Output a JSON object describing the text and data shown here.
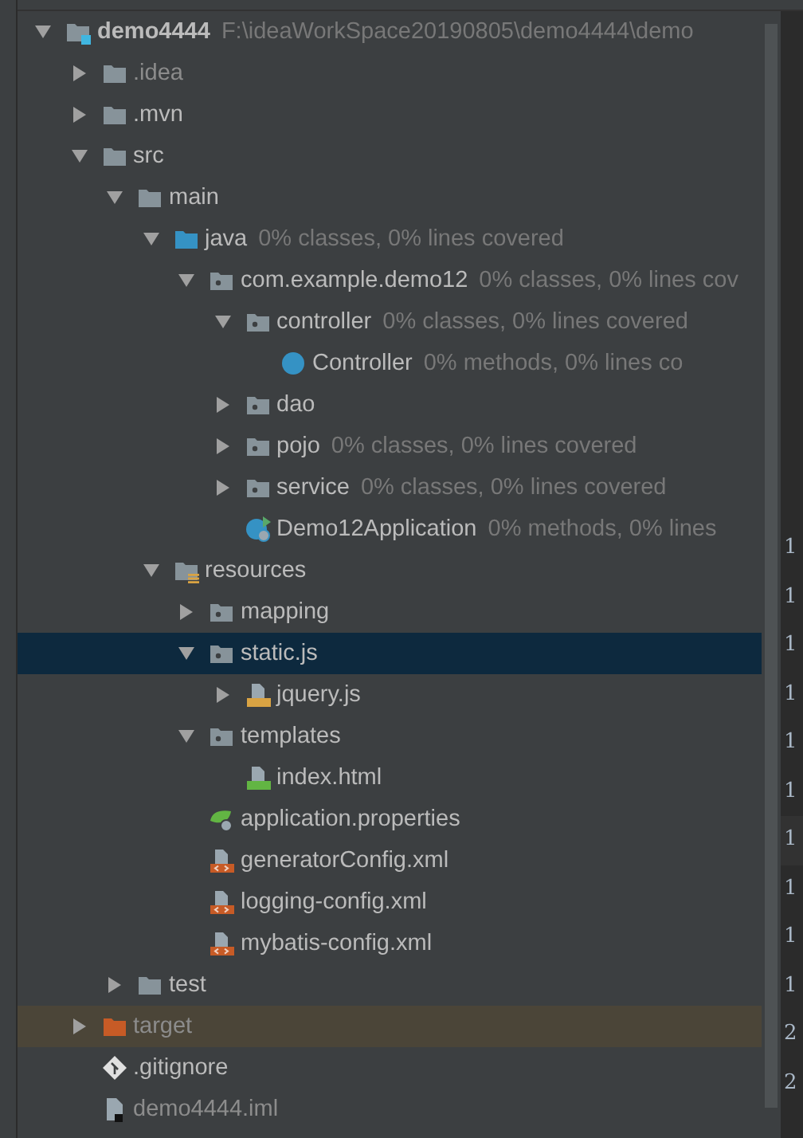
{
  "tree": [
    {
      "name": "demo4444",
      "hint": "F:\\ideaWorkSpace20190805\\demo4444\\demo",
      "kind": "module",
      "expanded": true,
      "selected": false,
      "ignored": false,
      "highlighted": false,
      "children": [
        {
          "name": ".idea",
          "kind": "folder",
          "expanded": false,
          "selected": false,
          "ignored": true,
          "highlighted": false
        },
        {
          "name": ".mvn",
          "kind": "folder",
          "expanded": false,
          "selected": false,
          "ignored": false,
          "highlighted": false
        },
        {
          "name": "src",
          "kind": "folder",
          "expanded": true,
          "selected": false,
          "ignored": false,
          "highlighted": false,
          "children": [
            {
              "name": "main",
              "kind": "folder",
              "expanded": true,
              "selected": false,
              "ignored": false,
              "highlighted": false,
              "children": [
                {
                  "name": "java",
                  "hint": "0% classes, 0% lines covered",
                  "kind": "source-folder",
                  "expanded": true,
                  "selected": false,
                  "ignored": false,
                  "highlighted": false,
                  "children": [
                    {
                      "name": "com.example.demo12",
                      "hint": "0% classes, 0% lines cov",
                      "kind": "package",
                      "expanded": true,
                      "selected": false,
                      "ignored": false,
                      "highlighted": false,
                      "children": [
                        {
                          "name": "controller",
                          "hint": "0% classes, 0% lines covered",
                          "kind": "package",
                          "expanded": true,
                          "selected": false,
                          "ignored": false,
                          "highlighted": false,
                          "children": [
                            {
                              "name": "Controller",
                              "hint": "0% methods, 0% lines co",
                              "kind": "class",
                              "selected": false,
                              "ignored": false,
                              "highlighted": false
                            }
                          ]
                        },
                        {
                          "name": "dao",
                          "kind": "package",
                          "expanded": false,
                          "selected": false,
                          "ignored": false,
                          "highlighted": false
                        },
                        {
                          "name": "pojo",
                          "hint": "0% classes, 0% lines covered",
                          "kind": "package",
                          "expanded": false,
                          "selected": false,
                          "ignored": false,
                          "highlighted": false
                        },
                        {
                          "name": "service",
                          "hint": "0% classes, 0% lines covered",
                          "kind": "package",
                          "expanded": false,
                          "selected": false,
                          "ignored": false,
                          "highlighted": false
                        },
                        {
                          "name": "Demo12Application",
                          "hint": "0% methods, 0% lines",
                          "kind": "spring-app",
                          "selected": false,
                          "ignored": false,
                          "highlighted": false
                        }
                      ]
                    }
                  ]
                },
                {
                  "name": "resources",
                  "kind": "resources-folder",
                  "expanded": true,
                  "selected": false,
                  "ignored": false,
                  "highlighted": false,
                  "children": [
                    {
                      "name": "mapping",
                      "kind": "package",
                      "expanded": false,
                      "selected": false,
                      "ignored": false,
                      "highlighted": false
                    },
                    {
                      "name": "static.js",
                      "kind": "package",
                      "expanded": true,
                      "selected": true,
                      "ignored": false,
                      "highlighted": false,
                      "children": [
                        {
                          "name": "jquery.js",
                          "kind": "js",
                          "expanded": false,
                          "selected": false,
                          "ignored": false,
                          "highlighted": false
                        }
                      ]
                    },
                    {
                      "name": "templates",
                      "kind": "package",
                      "expanded": true,
                      "selected": false,
                      "ignored": false,
                      "highlighted": false,
                      "children": [
                        {
                          "name": "index.html",
                          "kind": "html",
                          "selected": false,
                          "ignored": false,
                          "highlighted": false
                        }
                      ]
                    },
                    {
                      "name": "application.properties",
                      "kind": "properties",
                      "selected": false,
                      "ignored": false,
                      "highlighted": false
                    },
                    {
                      "name": "generatorConfig.xml",
                      "kind": "xml",
                      "selected": false,
                      "ignored": false,
                      "highlighted": false
                    },
                    {
                      "name": "logging-config.xml",
                      "kind": "xml",
                      "selected": false,
                      "ignored": false,
                      "highlighted": false
                    },
                    {
                      "name": "mybatis-config.xml",
                      "kind": "xml",
                      "selected": false,
                      "ignored": false,
                      "highlighted": false
                    }
                  ]
                }
              ]
            },
            {
              "name": "test",
              "kind": "folder",
              "expanded": false,
              "selected": false,
              "ignored": false,
              "highlighted": false
            }
          ]
        },
        {
          "name": "target",
          "kind": "excluded-folder",
          "expanded": false,
          "selected": false,
          "ignored": true,
          "highlighted": true
        },
        {
          "name": ".gitignore",
          "kind": "git",
          "selected": false,
          "ignored": false,
          "highlighted": false
        },
        {
          "name": "demo4444.iml",
          "kind": "iml",
          "selected": false,
          "ignored": true,
          "highlighted": false
        }
      ]
    }
  ],
  "gutter": {
    "line_numbers": [
      "1",
      "1",
      "1",
      "1",
      "1",
      "1",
      "1",
      "1",
      "1",
      "1",
      "2",
      "2"
    ]
  }
}
